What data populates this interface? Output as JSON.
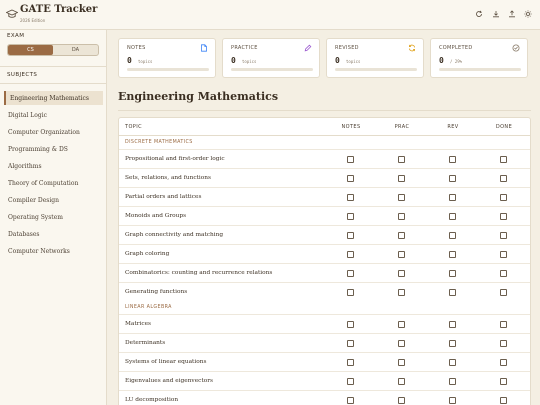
{
  "header": {
    "title": "GATE Tracker",
    "subtitle": "2026 Edition"
  },
  "sidebar": {
    "exam_label": "EXAM",
    "exam_options": [
      "CS",
      "DA"
    ],
    "exam_selected": "CS",
    "subjects_label": "SUBJECTS",
    "subjects": [
      "Engineering Mathematics",
      "Digital Logic",
      "Computer Organization",
      "Programming & DS",
      "Algorithms",
      "Theory of Computation",
      "Compiler Design",
      "Operating System",
      "Databases",
      "Computer Networks"
    ],
    "active_subject": "Engineering Mathematics"
  },
  "stats": [
    {
      "label": "NOTES",
      "value": "0",
      "unit": "topics",
      "icon": "document-icon",
      "color": "#3b82f6",
      "progress": 0
    },
    {
      "label": "PRACTICE",
      "value": "0",
      "unit": "topics",
      "icon": "pencil-icon",
      "color": "#9b59d0",
      "progress": 0
    },
    {
      "label": "REVISED",
      "value": "0",
      "unit": "topics",
      "icon": "refresh-icon",
      "color": "#e0a21a",
      "progress": 0
    },
    {
      "label": "COMPLETED",
      "value": "0",
      "unit": "/ 29%",
      "icon": "check-circle-icon",
      "color": "#8a7c6a",
      "progress": 0
    }
  ],
  "main": {
    "heading": "Engineering Mathematics",
    "columns": [
      "TOPIC",
      "NOTES",
      "PRAC",
      "REV",
      "DONE"
    ],
    "groups": [
      {
        "name": "DISCRETE MATHEMATICS",
        "topics": [
          "Propositional and first-order logic",
          "Sets, relations, and functions",
          "Partial orders and lattices",
          "Monoids and Groups",
          "Graph connectivity and matching",
          "Graph coloring",
          "Combinatorics: counting and recurrence relations",
          "Generating functions"
        ]
      },
      {
        "name": "LINEAR ALGEBRA",
        "topics": [
          "Matrices",
          "Determinants",
          "Systems of linear equations",
          "Eigenvalues and eigenvectors",
          "LU decomposition"
        ]
      }
    ]
  }
}
